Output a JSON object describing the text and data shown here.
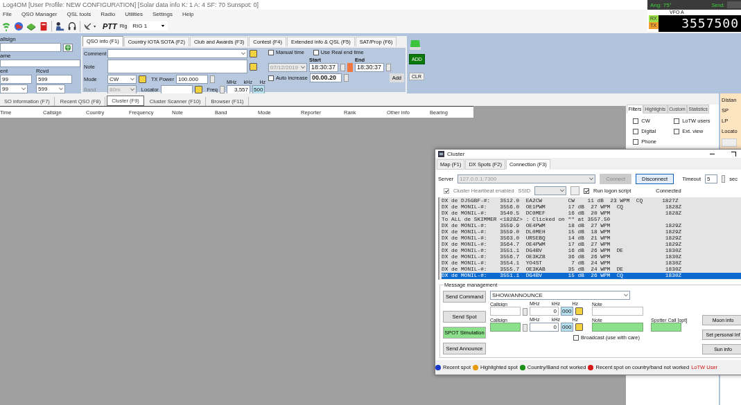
{
  "window": {
    "title": "Log4OM [User Profile: NEW CONFIGURATION] [Solar data info K: 1 A: 4 SF: 70 Sunspot: 0]"
  },
  "rotator": {
    "angle": "Ang: 75°",
    "send": "Send:"
  },
  "menu": [
    "File",
    "QSO Manager",
    "QSL tools",
    "Radio",
    "Utilities",
    "Settings",
    "Help"
  ],
  "toolbar": {
    "ptt": "PTT",
    "rig_label": "Rig",
    "rig": "RIG 1"
  },
  "vfo": {
    "label": "VFO A",
    "rx": "RX",
    "tx": "TX",
    "frequency": "3557500"
  },
  "qso_left": {
    "callsign_label": "allsign",
    "name_label": "ame",
    "sent_label": "ent",
    "rcvd_label": "Rcvd",
    "sent": "99",
    "rcvd": "599",
    "sent_report": "99",
    "rcvd_report": "599"
  },
  "qso_tabs": [
    {
      "label": "QSO info (F1)",
      "selected": true
    },
    {
      "label": "Country IOTA SOTA (F2)",
      "selected": false
    },
    {
      "label": "Club and Awards (F3)",
      "selected": false
    },
    {
      "label": "Contest (F4)",
      "selected": false
    },
    {
      "label": "Extended info & QSL (F5)",
      "selected": false
    },
    {
      "label": "SAT/Prop (F6)",
      "selected": false
    }
  ],
  "qso": {
    "comment_label": "Comment",
    "note_label": "Note",
    "mode_label": "Mode",
    "mode": "CW",
    "tx_power_label": "TX Power",
    "tx_power": "100.000",
    "band_label": "Band",
    "band": "80m",
    "band_disabled": true,
    "locator_label": "Locator",
    "freq_label": "Freq",
    "mhz": "MHz",
    "khz": "kHz",
    "hz": "Hz",
    "freq": "3,557",
    "freq_hz": "500"
  },
  "time": {
    "manual_time": {
      "label": "Manual time",
      "checked": false
    },
    "real_end": {
      "label": "Use Real end time",
      "checked": false
    },
    "date": "07/12/2019",
    "start_label": "Start",
    "start": "18:30:37",
    "end_label": "End",
    "end": "18:30:37",
    "auto_increase": {
      "label": "Auto increase",
      "checked": false
    },
    "increment": "00.00.20",
    "add": "Add"
  },
  "actions": {
    "add": "ADD",
    "clear": "CLR"
  },
  "bottom_tabs": [
    {
      "label": "SO information (F7)",
      "selected": false
    },
    {
      "label": "Recent QSO (F8)",
      "selected": false
    },
    {
      "label": "Cluster (F9)",
      "selected": true
    },
    {
      "label": "Cluster Scanner (F10)",
      "selected": false
    },
    {
      "label": "Browser (F11)",
      "selected": false
    }
  ],
  "table": {
    "columns": [
      "Time",
      "Callsign",
      "Country",
      "Frequency",
      "Note",
      "Band",
      "Mode",
      "Reporter",
      "Rank",
      "Other info",
      "Bearing"
    ]
  },
  "filters": {
    "tabs": [
      {
        "label": "Filters",
        "selected": true
      },
      {
        "label": "Highlights",
        "selected": false
      },
      {
        "label": "Custom",
        "selected": false
      },
      {
        "label": "Statistics",
        "selected": false
      }
    ],
    "options": [
      {
        "label": "CW",
        "checked": false
      },
      {
        "label": "LoTW users",
        "checked": false
      },
      {
        "label": "Digital",
        "checked": false
      },
      {
        "label": "Ext. view",
        "checked": false
      },
      {
        "label": "Phone",
        "checked": false
      }
    ]
  },
  "distance": {
    "labels": [
      "Distan",
      "SP",
      "LP",
      "Locato"
    ]
  },
  "cluster": {
    "title": "Cluster",
    "tabs": [
      {
        "label": "Map (F1)",
        "selected": false
      },
      {
        "label": "DX Spots (F2)",
        "selected": false
      },
      {
        "label": "Connection (F3)",
        "selected": true
      }
    ],
    "server_label": "Server",
    "server": "127.0.0.1:7300",
    "connect": {
      "label": "Connect",
      "disabled": true
    },
    "disconnect": {
      "label": "Disconnect",
      "disabled": false
    },
    "timeout_label": "Timeout",
    "timeout": "5",
    "sec": "sec",
    "heartbeat": {
      "label": "Cluster Heartbeat enabled",
      "checked": true
    },
    "ssid_label": "SSID",
    "logon": {
      "label": "Run logon script",
      "checked": true
    },
    "status": "Connected",
    "spots": [
      {
        "text": "DX de DJ5GBF-#:   3512.0  EA2CW        CW    11 dB  23 WPM  CQ      1827Z",
        "selected": false
      },
      {
        "text": "DX de MONIL-#:    3556.0  OE1PWM       17 dB  27 WPM  CQ             1828Z",
        "selected": false
      },
      {
        "text": "DX de MONIL-#:    3540.5  DC0MEF       16 dB  20 WPM                 1828Z",
        "selected": false
      },
      {
        "text": "To ALL de SKIMMER <1828Z> : Clicked on \"\" at 3557.50",
        "selected": false
      },
      {
        "text": "DX de MONIL-#:    3559.9  OE4PWM       18 dB  27 WPM                 1829Z",
        "selected": false
      },
      {
        "text": "DX de MONIL-#:    3559.0  DL0MEH       15 dB  18 WPM                 1829Z",
        "selected": false
      },
      {
        "text": "DX de MONIL-#:    3563.0  UR5EBQ       14 dB  21 WPM                 1829Z",
        "selected": false
      },
      {
        "text": "DX de MONIL-#:    3564.7  OE4PWM       17 dB  27 WPM                 1829Z",
        "selected": false
      },
      {
        "text": "DX de MONIL-#:    3551.1  DG4BV        16 dB  26 WPM  DE             1830Z",
        "selected": false
      },
      {
        "text": "DX de MONIL-#:    3556.7  OE3KZB       36 dB  26 WPM                 1830Z",
        "selected": false
      },
      {
        "text": "DX de MONIL-#:    3554.1  YO4ST         7 dB  24 WPM                 1830Z",
        "selected": false
      },
      {
        "text": "DX de MONIL-#:    3555.7  OE3KAB       35 dB  24 WPM  DE             1830Z",
        "selected": false
      },
      {
        "text": "DX de MONIL-#:    3551.1  DG4BV        15 dB  26 WPM  CQ             1830Z",
        "selected": true
      }
    ],
    "message": {
      "title": "Message management",
      "send_command": "Send Command",
      "command": "SHOW/ANNOUNCE",
      "send_spot": "Send Spot",
      "spot_simulation": "SPOT Simulation",
      "send_announce": "Send Announce",
      "spot_row": {
        "callsign_label": "Callsign",
        "mhz": "MHz",
        "khz": "kHz",
        "hz": "Hz",
        "khz_value": "0",
        "hz_value": "000",
        "note_label": "Note"
      },
      "simulation_row": {
        "callsign_label": "Callsign",
        "mhz": "MHz",
        "khz": "kHz",
        "hz": "Hz",
        "khz_value": "0",
        "hz_value": "000",
        "note_label": "Note",
        "spotter_label": "Spotter Call [opt]"
      },
      "broadcast": {
        "label": "Broadcast (use with care)",
        "checked": false
      },
      "side_buttons": [
        "Moon info",
        "Set personal Inf",
        "Sun info"
      ]
    },
    "legend": [
      {
        "label": "Recent spot",
        "color": "#1838c8"
      },
      {
        "label": "Highlighted spot",
        "color": "#e89a10"
      },
      {
        "label": "Country/Band not worked",
        "color": "#189018"
      },
      {
        "label": "Recent spot on country/band not worked",
        "color": "#d81818"
      }
    ],
    "lotw": "LoTW User"
  }
}
